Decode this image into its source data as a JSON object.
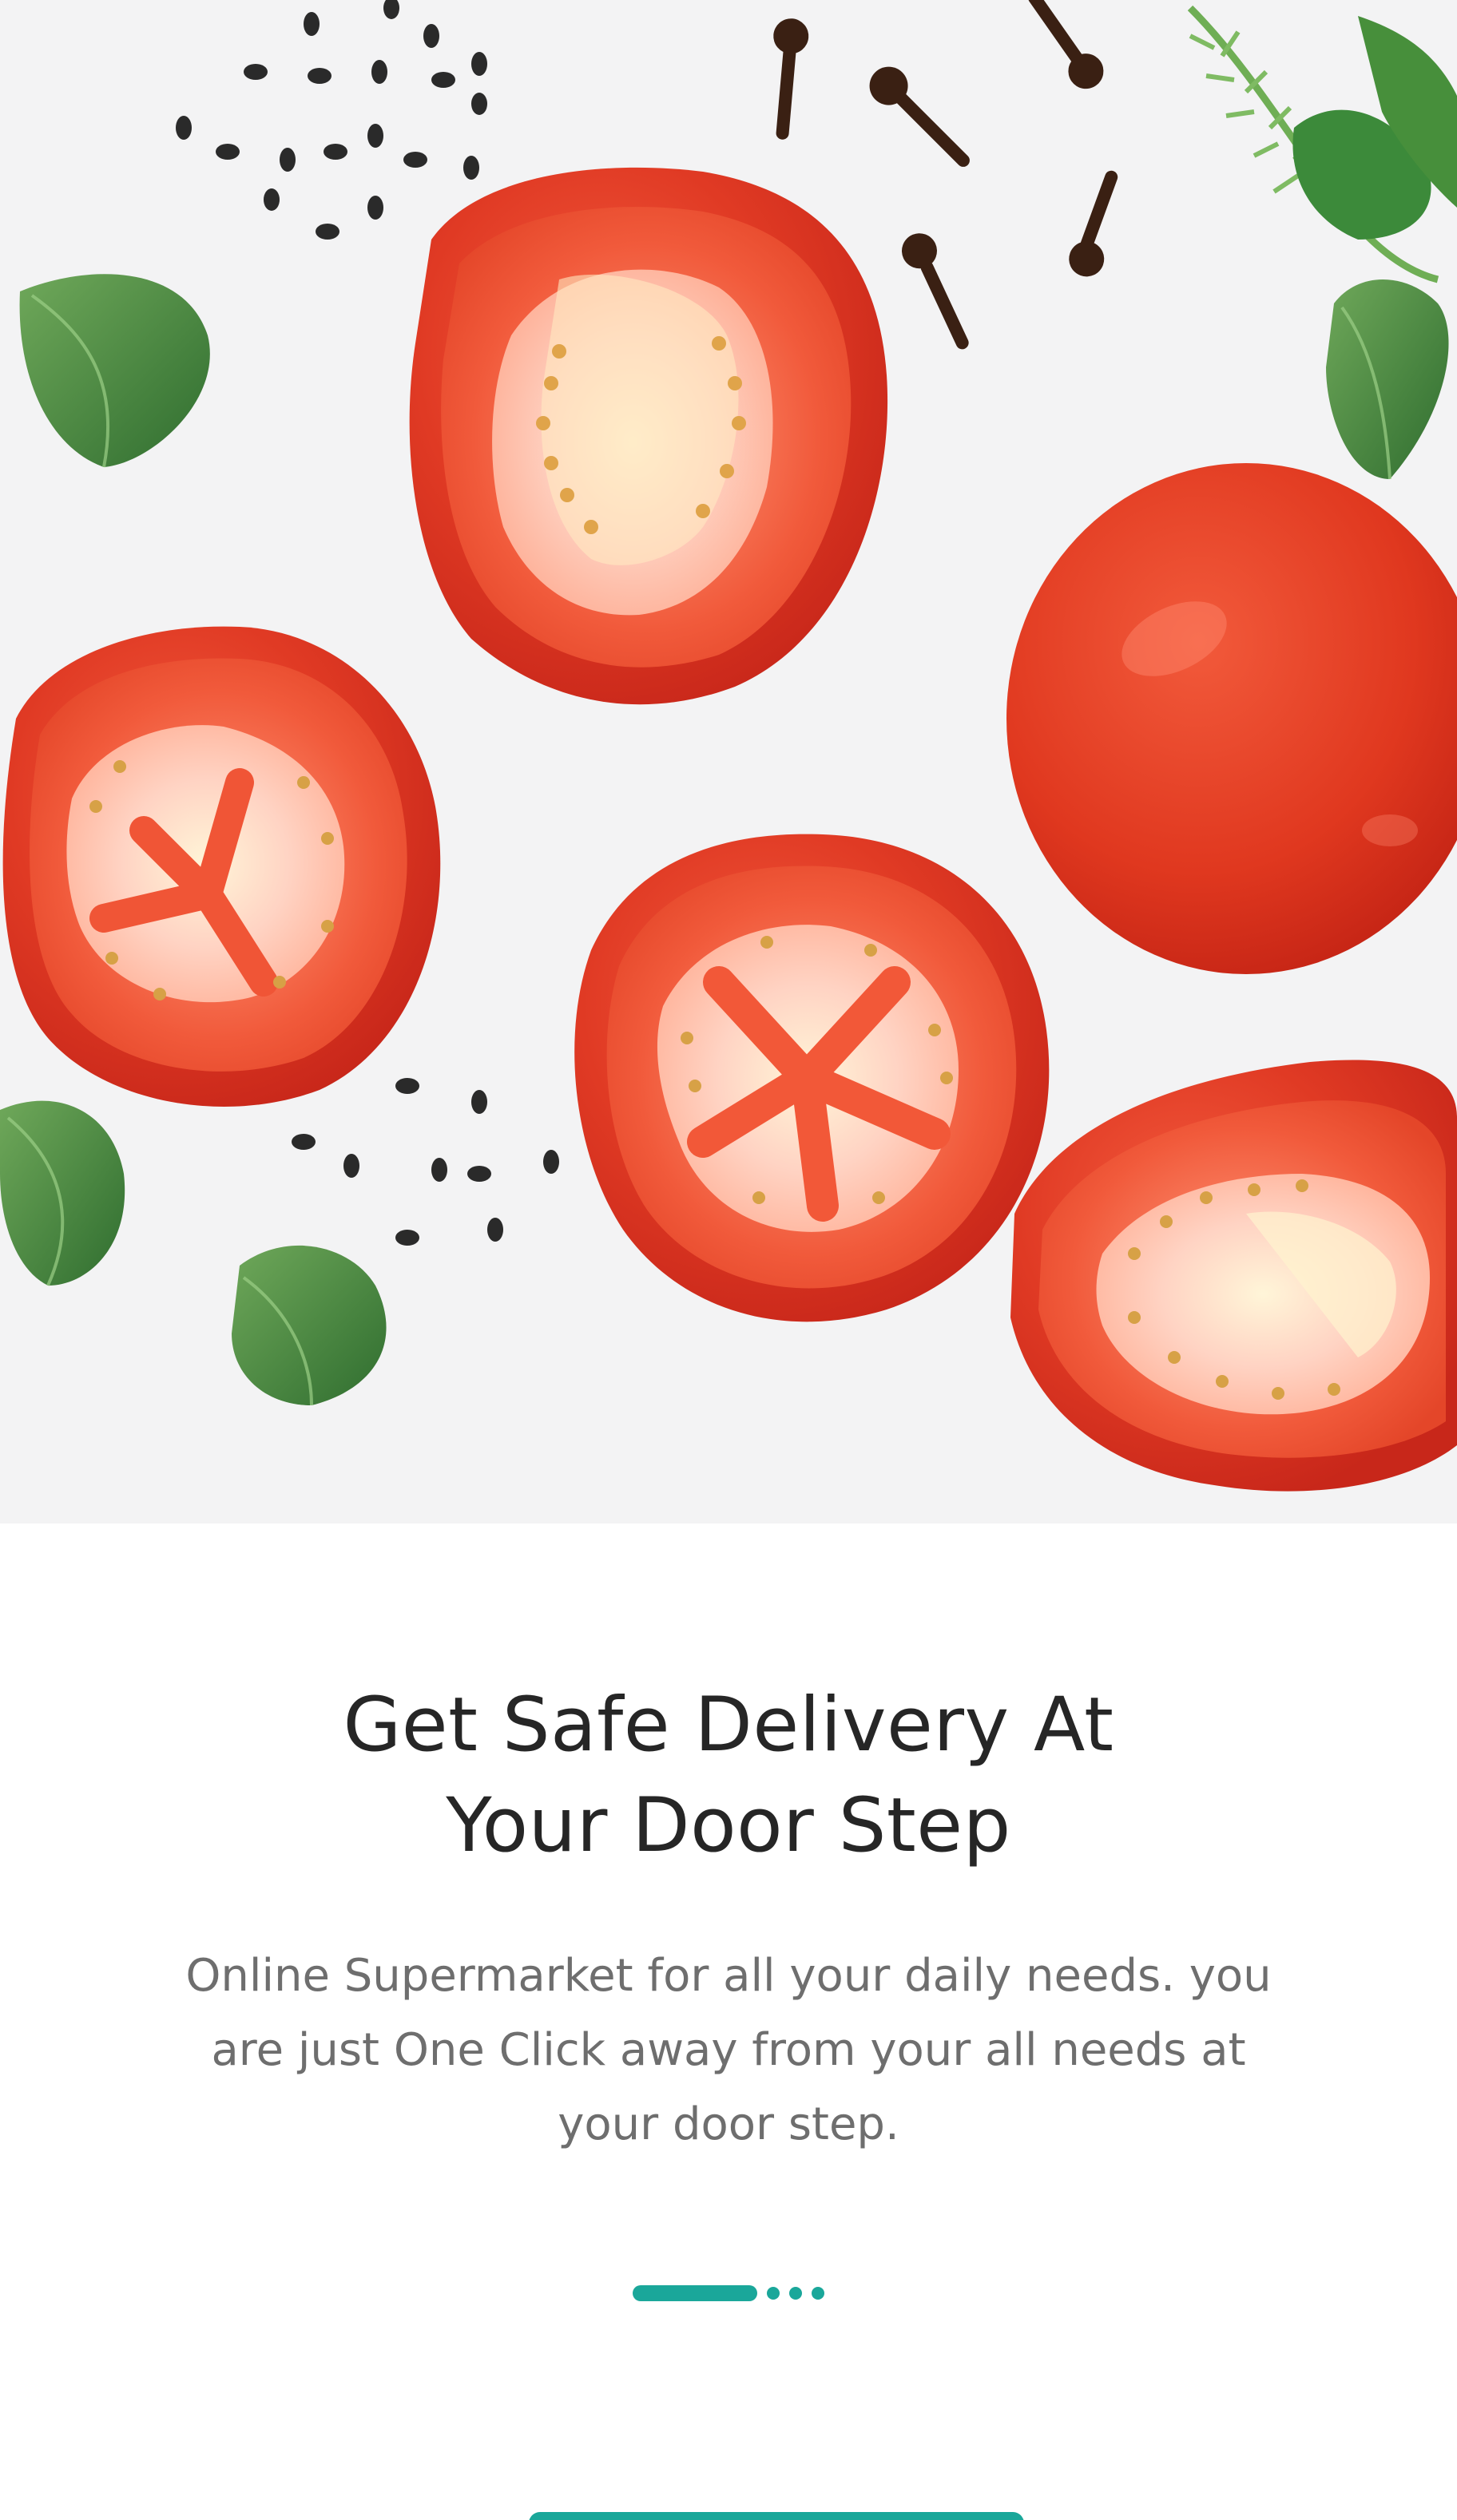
{
  "onboarding": {
    "headline_line1": "Get Safe Delivery At",
    "headline_line2": "Your Door Step",
    "body_line1": "Online Supermarket for all your daily needs. you",
    "body_line2": "are just One Click away from your all needs at",
    "body_line3": "your door step.",
    "pager": {
      "total_pages": 4,
      "active_page": 1
    }
  },
  "colors": {
    "accent": "#1aa79a",
    "headline": "#262626",
    "body": "#6e6e6e",
    "hero_background": "#f3f3f4"
  }
}
